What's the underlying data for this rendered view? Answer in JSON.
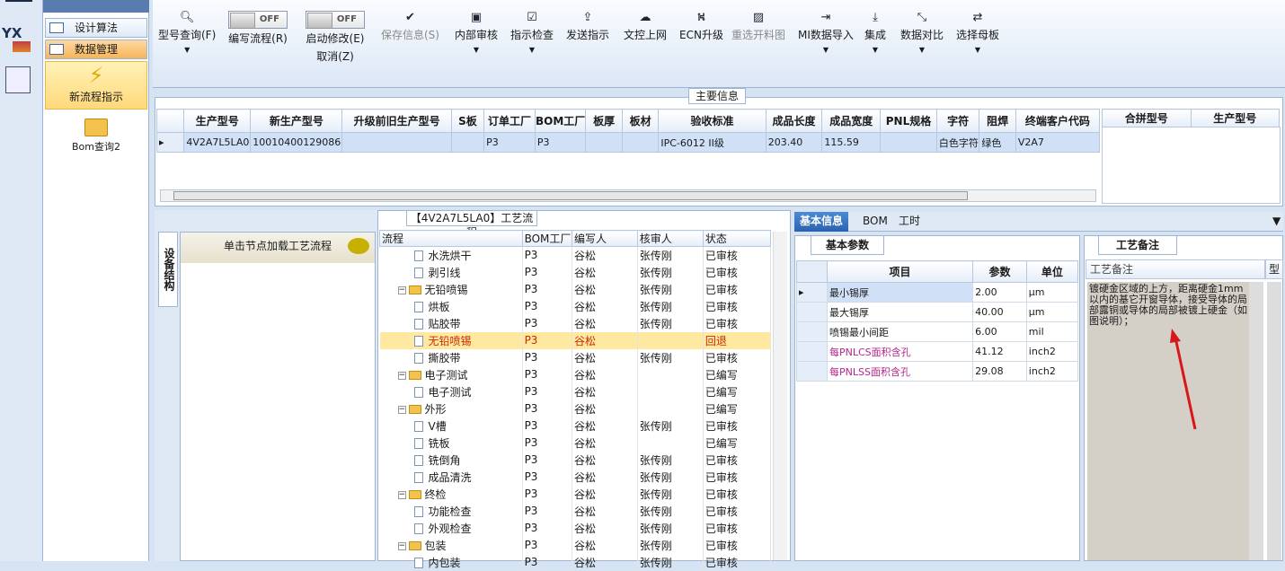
{
  "nav": {
    "items": [
      "设计算法",
      "数据管理"
    ],
    "active_label": "新流程指示",
    "bom_label": "Bom查询2"
  },
  "ribbon": {
    "buttons": [
      {
        "label": "型号查询(F)",
        "icon": "search-icon"
      },
      {
        "label": "编写流程(R)",
        "toggle": "OFF"
      },
      {
        "label": "启动修改(E)",
        "sub": "取消(Z)",
        "toggle": "OFF"
      },
      {
        "label": "保存信息(S)",
        "icon": "check-icon",
        "disabled": true
      },
      {
        "label": "内部审核",
        "icon": "print-icon"
      },
      {
        "label": "指示检查",
        "icon": "checkbox-icon"
      },
      {
        "label": "发送指示",
        "icon": "upload-icon"
      },
      {
        "label": "文控上网",
        "icon": "cloud-upload-icon"
      },
      {
        "label": "ECN升级",
        "icon": "road-icon"
      },
      {
        "label": "重选开料图",
        "icon": "image-icon",
        "disabled": true
      },
      {
        "label": "MI数据导入",
        "icon": "import-icon"
      },
      {
        "label": "集成",
        "icon": "download-icon"
      },
      {
        "label": "数据对比",
        "icon": "compress-icon"
      },
      {
        "label": "选择母板",
        "icon": "shuffle-icon"
      }
    ]
  },
  "main": {
    "title": "主要信息",
    "columns": [
      "生产型号",
      "新生产型号",
      "升级前旧生产型号",
      "S板",
      "订单工厂",
      "BOM工厂",
      "板厚",
      "板材",
      "验收标准",
      "成品长度",
      "成品宽度",
      "PNL规格",
      "字符",
      "阻焊",
      "终端客户代码"
    ],
    "row": [
      "4V2A7L5LA0",
      "10010400129086",
      "",
      "",
      "P3",
      "P3",
      "",
      "",
      "IPC-6012 II级",
      "203.40",
      "115.59",
      "",
      "白色字符",
      "绿色",
      "V2A7"
    ],
    "side_columns": [
      "合拼型号",
      "生产型号"
    ]
  },
  "equip": {
    "tab_label": "设备结构",
    "header": "单击节点加载工艺流程"
  },
  "tree": {
    "title": "【4V2A7L5LA0】工艺流程",
    "columns": [
      "流程",
      "BOM工厂",
      "编写人",
      "核审人",
      "状态"
    ],
    "rows": [
      {
        "level": 2,
        "name": "水洗烘干",
        "bom": "P3",
        "writer": "谷松",
        "reviewer": "张传刚",
        "status": "已审核"
      },
      {
        "level": 2,
        "name": "剥引线",
        "bom": "P3",
        "writer": "谷松",
        "reviewer": "张传刚",
        "status": "已审核"
      },
      {
        "level": 1,
        "name": "无铅喷锡",
        "bom": "P3",
        "writer": "谷松",
        "reviewer": "张传刚",
        "status": "已审核"
      },
      {
        "level": 2,
        "name": "烘板",
        "bom": "P3",
        "writer": "谷松",
        "reviewer": "张传刚",
        "status": "已审核"
      },
      {
        "level": 2,
        "name": "贴胶带",
        "bom": "P3",
        "writer": "谷松",
        "reviewer": "张传刚",
        "status": "已审核"
      },
      {
        "level": 2,
        "name": "无铅喷锡",
        "bom": "P3",
        "writer": "谷松",
        "reviewer": "",
        "status": "回退",
        "selected": true
      },
      {
        "level": 2,
        "name": "撕胶带",
        "bom": "P3",
        "writer": "谷松",
        "reviewer": "张传刚",
        "status": "已审核"
      },
      {
        "level": 1,
        "name": "电子测试",
        "bom": "P3",
        "writer": "谷松",
        "reviewer": "",
        "status": "已编写"
      },
      {
        "level": 2,
        "name": "电子测试",
        "bom": "P3",
        "writer": "谷松",
        "reviewer": "",
        "status": "已编写"
      },
      {
        "level": 1,
        "name": "外形",
        "bom": "P3",
        "writer": "谷松",
        "reviewer": "",
        "status": "已编写"
      },
      {
        "level": 2,
        "name": "V槽",
        "bom": "P3",
        "writer": "谷松",
        "reviewer": "张传刚",
        "status": "已审核"
      },
      {
        "level": 2,
        "name": "铣板",
        "bom": "P3",
        "writer": "谷松",
        "reviewer": "",
        "status": "已编写"
      },
      {
        "level": 2,
        "name": "铣倒角",
        "bom": "P3",
        "writer": "谷松",
        "reviewer": "张传刚",
        "status": "已审核"
      },
      {
        "level": 2,
        "name": "成品清洗",
        "bom": "P3",
        "writer": "谷松",
        "reviewer": "张传刚",
        "status": "已审核"
      },
      {
        "level": 1,
        "name": "终检",
        "bom": "P3",
        "writer": "谷松",
        "reviewer": "张传刚",
        "status": "已审核"
      },
      {
        "level": 2,
        "name": "功能检查",
        "bom": "P3",
        "writer": "谷松",
        "reviewer": "张传刚",
        "status": "已审核"
      },
      {
        "level": 2,
        "name": "外观检查",
        "bom": "P3",
        "writer": "谷松",
        "reviewer": "张传刚",
        "status": "已审核"
      },
      {
        "level": 1,
        "name": "包装",
        "bom": "P3",
        "writer": "谷松",
        "reviewer": "张传刚",
        "status": "已审核"
      },
      {
        "level": 2,
        "name": "内包装",
        "bom": "P3",
        "writer": "谷松",
        "reviewer": "张传刚",
        "status": "已审核"
      }
    ]
  },
  "right": {
    "tabs": [
      "基本信息",
      "BOM",
      "工时"
    ],
    "param_tab": "基本参数",
    "param_columns": [
      "项目",
      "参数",
      "单位"
    ],
    "params": [
      {
        "item": "最小锡厚",
        "value": "2.00",
        "unit": "μm",
        "pink": false
      },
      {
        "item": "最大锡厚",
        "value": "40.00",
        "unit": "μm",
        "pink": false
      },
      {
        "item": "喷锡最小间距",
        "value": "6.00",
        "unit": "mil",
        "pink": false
      },
      {
        "item": "每PNLCS面积含孔",
        "value": "41.12",
        "unit": "inch2",
        "pink": true
      },
      {
        "item": "每PNLSS面积含孔",
        "value": "29.08",
        "unit": "inch2",
        "pink": true
      }
    ],
    "note_tab": "工艺备注",
    "note_header": "工艺备注",
    "note_header2": "型",
    "note_text": "镀硬金区域的上方，距离硬金1mm以内的基它开窗导体，接受导体的局部露铜或导体的局部被镀上硬金（如图说明）；"
  }
}
